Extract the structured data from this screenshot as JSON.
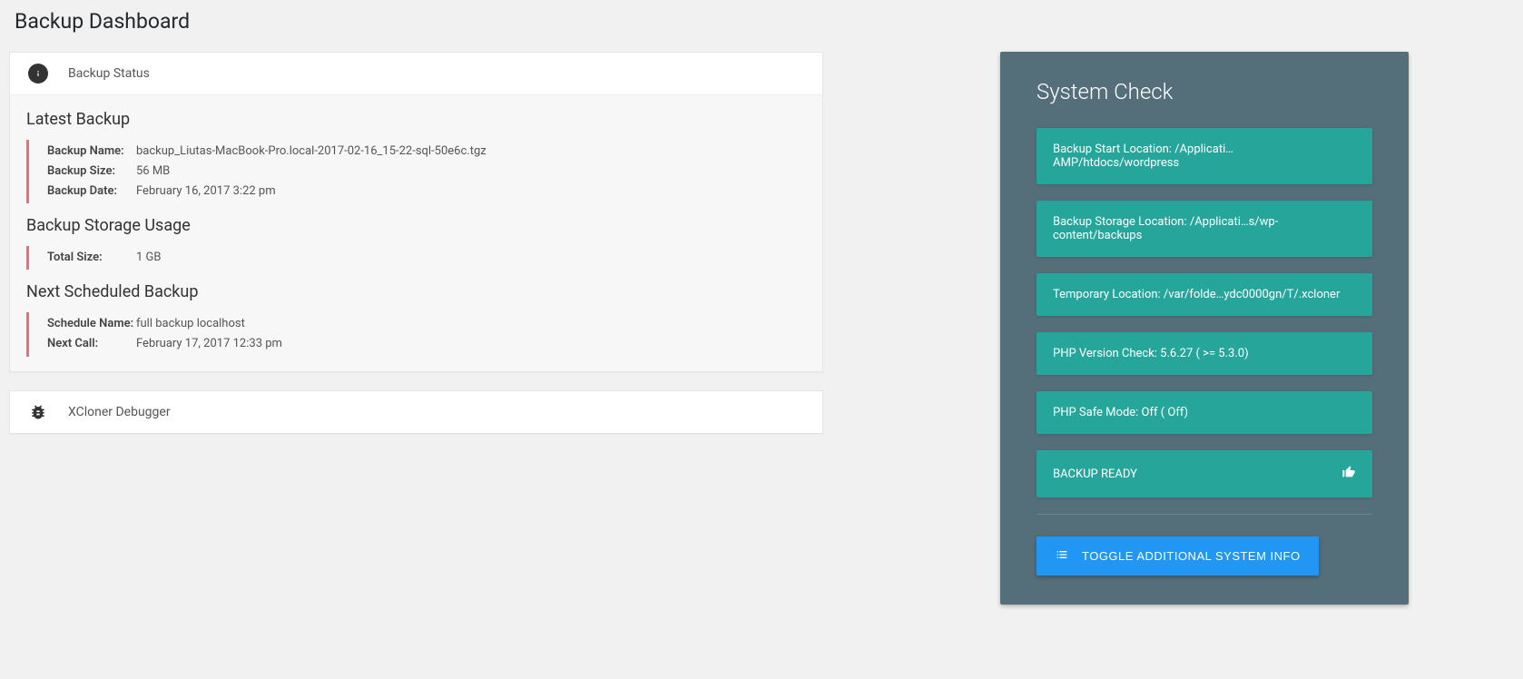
{
  "page_title": "Backup Dashboard",
  "status": {
    "header": "Backup Status",
    "latest_title": "Latest Backup",
    "labels": {
      "name": "Backup Name:",
      "size": "Backup Size:",
      "date": "Backup Date:"
    },
    "latest": {
      "name": "backup_Liutas-MacBook-Pro.local-2017-02-16_15-22-sql-50e6c.tgz",
      "size": "56 MB",
      "date": "February 16, 2017 3:22 pm"
    },
    "storage_title": "Backup Storage Usage",
    "storage_labels": {
      "total": "Total Size:"
    },
    "storage": {
      "total": "1 GB"
    },
    "next_title": "Next Scheduled Backup",
    "next_labels": {
      "name": "Schedule Name:",
      "call": "Next Call:"
    },
    "next": {
      "name": "full backup localhost",
      "call": "February 17, 2017 12:33 pm"
    }
  },
  "debugger": {
    "header": "XCloner Debugger"
  },
  "system": {
    "title": "System Check",
    "items": [
      "Backup Start Location: /Applicati…AMP/htdocs/wordpress",
      "Backup Storage Location: /Applicati…s/wp-content/backups",
      "Temporary Location: /var/folde…ydc0000gn/T/.xcloner",
      "PHP Version Check: 5.6.27 ( >= 5.3.0)",
      "PHP Safe Mode: Off ( Off)",
      "BACKUP READY"
    ],
    "toggle": "TOGGLE ADDITIONAL SYSTEM INFO"
  }
}
